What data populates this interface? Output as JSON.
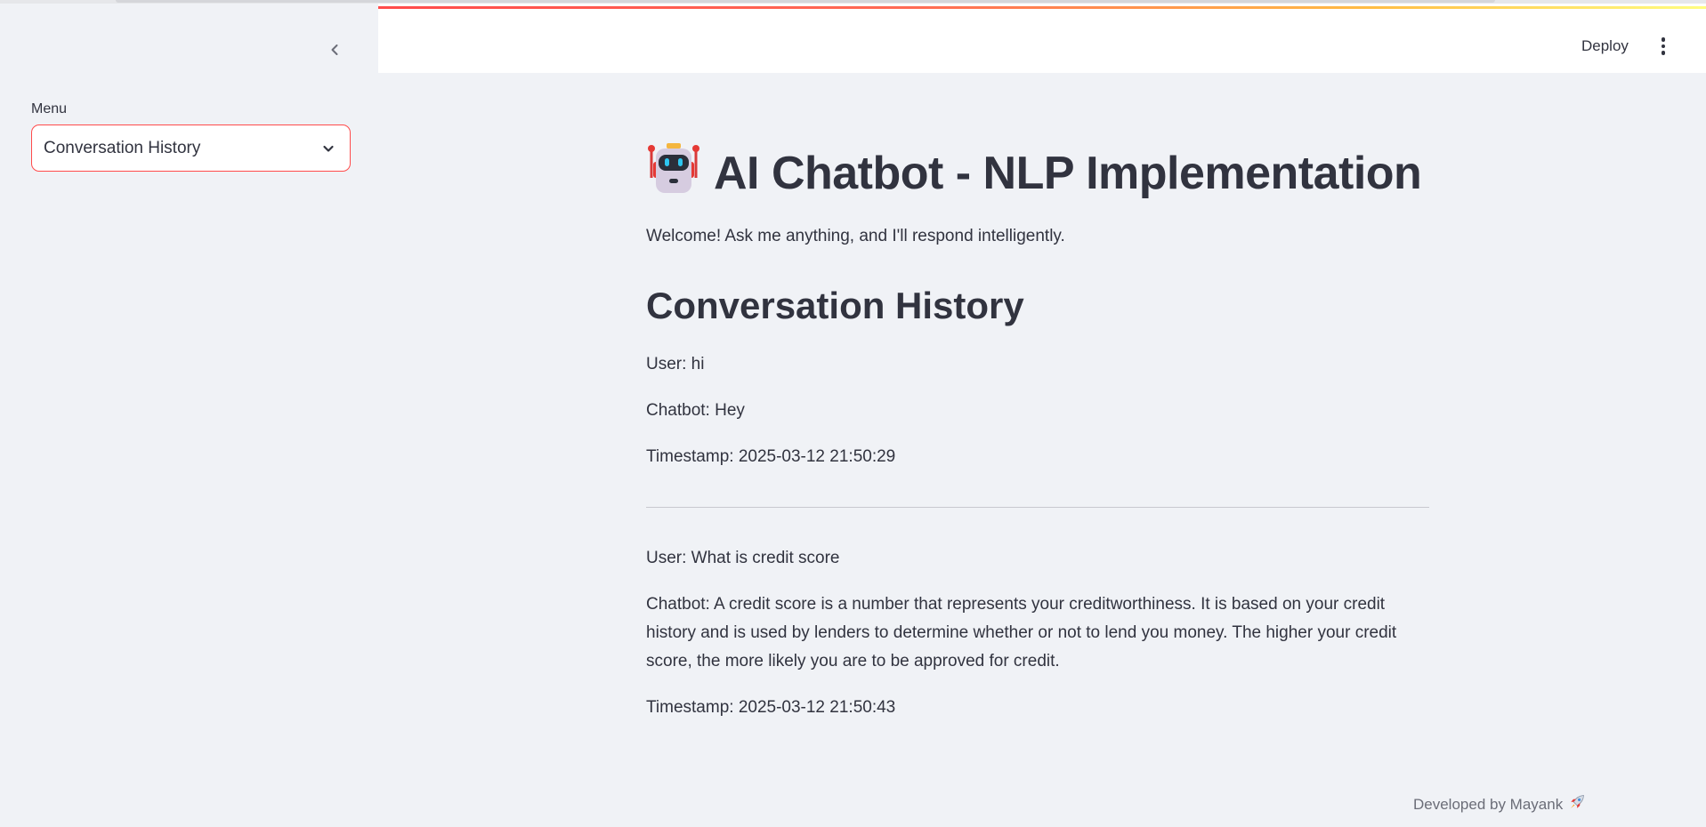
{
  "sidebar": {
    "menu_label": "Menu",
    "select_value": "Conversation History"
  },
  "header": {
    "deploy_label": "Deploy"
  },
  "main": {
    "title": "AI Chatbot - NLP Implementation",
    "welcome": "Welcome! Ask me anything, and I'll respond intelligently.",
    "section_title": "Conversation History",
    "conversations": [
      {
        "user": "User: hi",
        "bot": "Chatbot: Hey",
        "timestamp": "Timestamp: 2025-03-12 21:50:29"
      },
      {
        "user": "User: What is credit score",
        "bot": "Chatbot: A credit score is a number that represents your creditworthiness. It is based on your credit history and is used by lenders to determine whether or not to lend you money. The higher your credit score, the more likely you are to be approved for credit.",
        "timestamp": "Timestamp: 2025-03-12 21:50:43"
      }
    ]
  },
  "footer": {
    "credit": "Developed by Mayank"
  },
  "colors": {
    "accent": "#ff4b4b",
    "text": "#31333f",
    "background": "#f0f2f6"
  },
  "icons": {
    "collapse": "chevron-left-icon",
    "select": "chevron-down-icon",
    "menu": "kebab-menu-icon",
    "title": "robot-emoji-icon",
    "footer": "rocket-emoji-icon"
  }
}
